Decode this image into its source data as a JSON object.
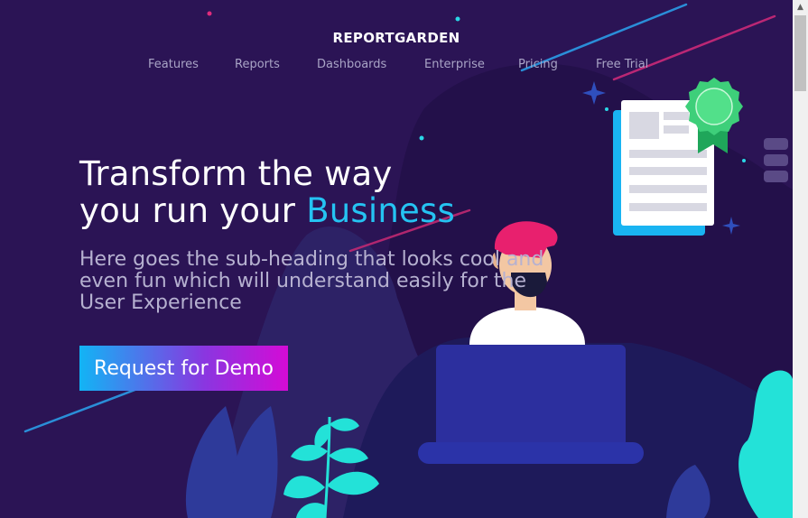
{
  "header": {
    "brand": "REPORTGARDEN",
    "nav": [
      {
        "label": "Features"
      },
      {
        "label": "Reports"
      },
      {
        "label": "Dashboards"
      },
      {
        "label": "Enterprise"
      },
      {
        "label": "Pricing"
      },
      {
        "label": "Free Trial"
      }
    ]
  },
  "hero": {
    "title_line1": "Transform the way",
    "title_line2_prefix": "you run your ",
    "title_line2_accent": "Business",
    "subheading": "Here goes the sub-heading that looks cool and even fun which will understand easily for the User Experience",
    "cta_label": "Request for Demo"
  },
  "colors": {
    "background": "#2b1455",
    "accent": "#25c3f2",
    "cta_gradient_start": "#12b4f5",
    "cta_gradient_end": "#d40bd6",
    "leaf": "#23e2d8",
    "badge": "#3ecf7a",
    "hair": "#e8206e"
  },
  "icons": {
    "scroll_up": "scroll-up-arrow-icon",
    "sparkle": "sparkle-icon",
    "badge": "award-ribbon-icon"
  }
}
